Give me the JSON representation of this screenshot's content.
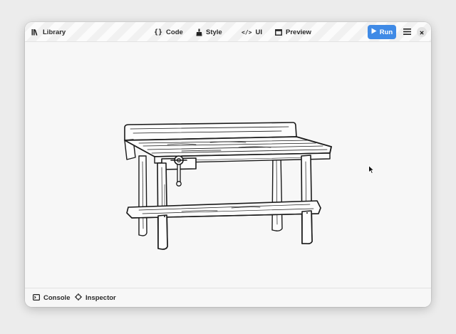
{
  "toolbar": {
    "library_label": "Library",
    "code_label": "Code",
    "style_label": "Style",
    "ui_label": "UI",
    "preview_label": "Preview",
    "run_label": "Run"
  },
  "statusbar": {
    "console_label": "Console",
    "inspector_label": "Inspector"
  },
  "colors": {
    "accent": "#3f8ae6",
    "canvas_bg": "#f7f7f7",
    "ink": "#1a1a1a"
  },
  "icons": [
    "library-icon",
    "code-braces-icon",
    "style-brush-icon",
    "ui-tag-icon",
    "preview-window-icon",
    "play-icon",
    "hamburger-menu-icon",
    "close-icon",
    "console-icon",
    "inspector-crosshair-icon",
    "mouse-cursor-icon"
  ]
}
